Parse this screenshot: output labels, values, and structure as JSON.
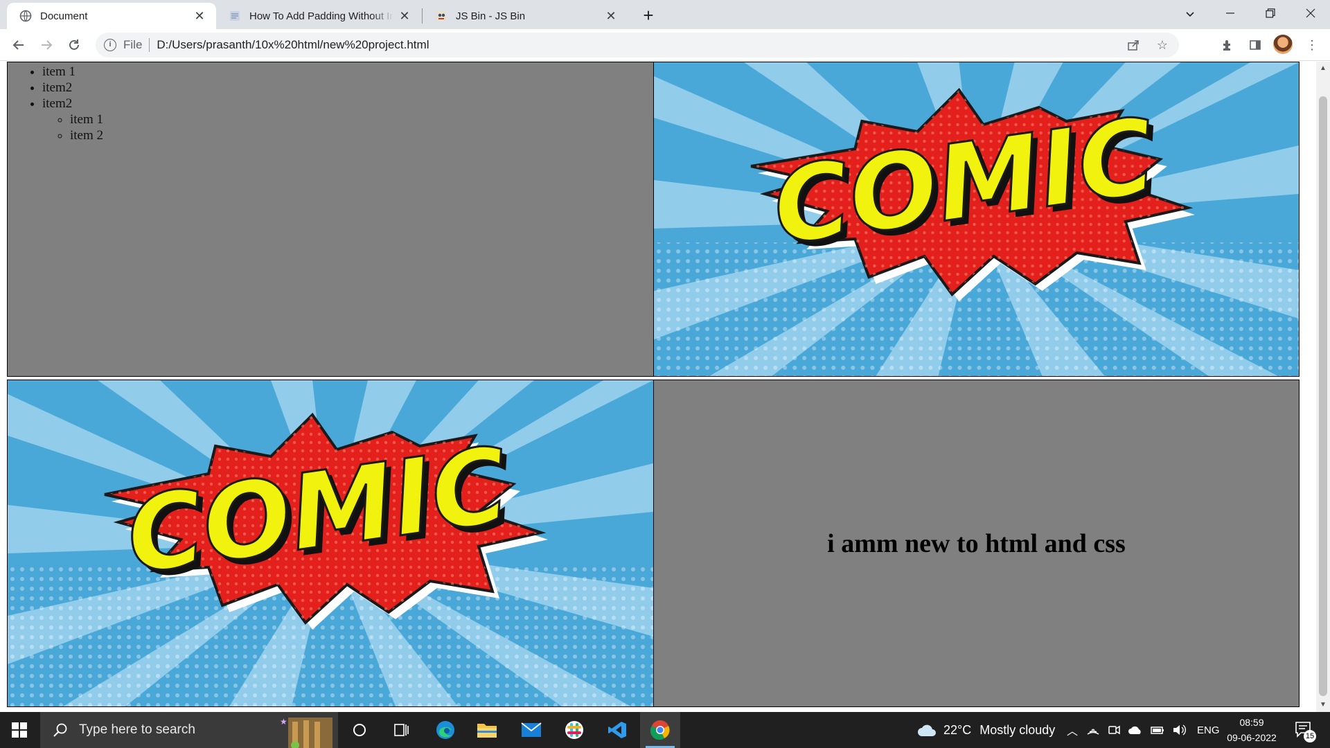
{
  "browser": {
    "tabs": [
      {
        "title": "Document",
        "active": true
      },
      {
        "title": "How To Add Padding Without Inc",
        "active": false
      },
      {
        "title": "JS Bin - JS Bin",
        "active": false
      }
    ],
    "new_tab_label": "+",
    "address": {
      "scheme": "File",
      "url": "D:/Users/prasanth/10x%20html/new%20project.html"
    }
  },
  "page": {
    "list": {
      "items": [
        "item 1",
        "item2",
        "item2"
      ],
      "nested_items": [
        "item 1",
        "item 2"
      ]
    },
    "images": [
      {
        "label": "COMIC"
      },
      {
        "label": "COMIC"
      }
    ],
    "heading": "i amm new to html and css",
    "cell_background": "#808080"
  },
  "taskbar": {
    "search_placeholder": "Type here to search",
    "weather": {
      "temperature": "22°C",
      "condition": "Mostly cloudy"
    },
    "language": "ENG",
    "time": "08:59",
    "date": "09-06-2022",
    "notification_count": "15"
  }
}
